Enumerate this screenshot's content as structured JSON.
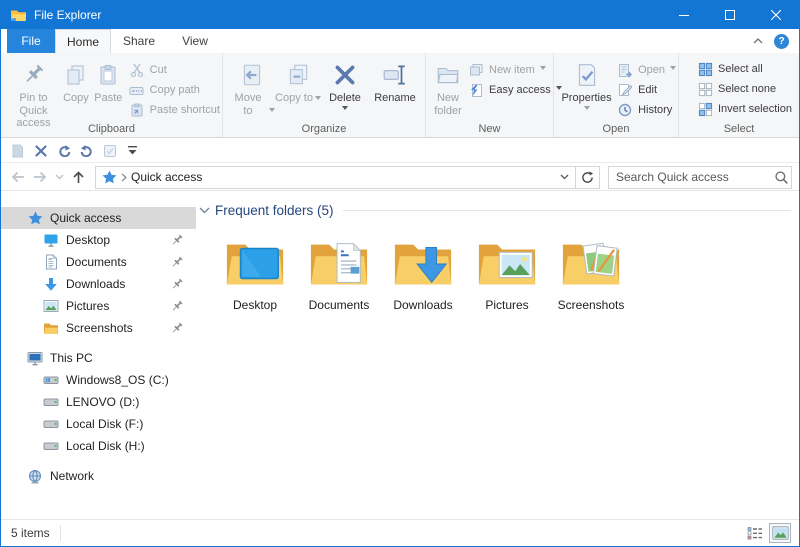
{
  "window": {
    "title": "File Explorer"
  },
  "glyphs": {
    "help": "?"
  },
  "tabs": {
    "file": "File",
    "home": "Home",
    "share": "Share",
    "view": "View"
  },
  "ribbon": {
    "clipboard": {
      "label": "Clipboard",
      "pin": "Pin to Quick access",
      "copy": "Copy",
      "paste": "Paste",
      "cut": "Cut",
      "copy_path": "Copy path",
      "paste_shortcut": "Paste shortcut"
    },
    "organize": {
      "label": "Organize",
      "move_to": "Move to",
      "copy_to": "Copy to",
      "delete": "Delete",
      "rename": "Rename"
    },
    "new_group": {
      "label": "New",
      "new_folder": "New folder",
      "new_item": "New item",
      "easy_access": "Easy access"
    },
    "open_group": {
      "label": "Open",
      "properties": "Properties",
      "open": "Open",
      "edit": "Edit",
      "history": "History"
    },
    "select_group": {
      "label": "Select",
      "select_all": "Select all",
      "select_none": "Select none",
      "invert_selection": "Invert selection"
    }
  },
  "address": {
    "path": "Quick access",
    "search_placeholder": "Search Quick access"
  },
  "sidebar": {
    "quick_access": "Quick access",
    "quick_items": [
      {
        "label": "Desktop"
      },
      {
        "label": "Documents"
      },
      {
        "label": "Downloads"
      },
      {
        "label": "Pictures"
      },
      {
        "label": "Screenshots"
      }
    ],
    "this_pc": "This PC",
    "drives": [
      "Windows8_OS (C:)",
      "LENOVO (D:)",
      "Local Disk (F:)",
      "Local Disk (H:)"
    ],
    "network": "Network"
  },
  "content": {
    "section_title": "Frequent folders (5)",
    "folders": [
      {
        "name": "Desktop"
      },
      {
        "name": "Documents"
      },
      {
        "name": "Downloads"
      },
      {
        "name": "Pictures"
      },
      {
        "name": "Screenshots"
      }
    ]
  },
  "status": {
    "items_count": "5 items"
  },
  "colors": {
    "accent": "#1476d4",
    "file_tab": "#2585dd",
    "selection_bg": "#d9d9d9",
    "heading": "#26477d",
    "folder_front": "#f7cf66",
    "folder_back": "#e2a33c",
    "disabled_icon": "#c3d0e0",
    "steel_icon": "#5b79ad"
  }
}
